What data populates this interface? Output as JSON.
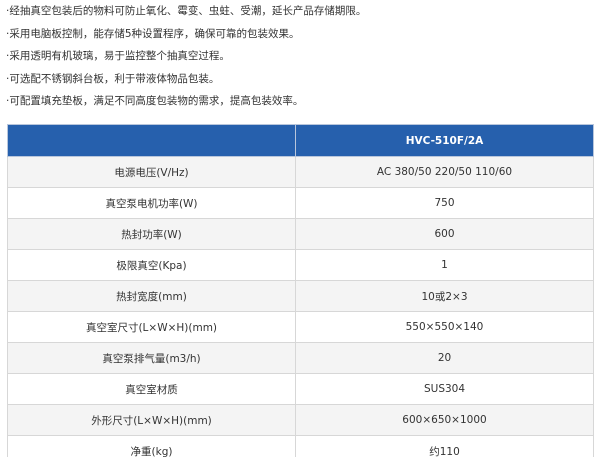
{
  "features": [
    "·经抽真空包装后的物料可防止氧化、霉变、虫蛀、受潮，延长产品存储期限。",
    "·采用电脑板控制，能存储5种设置程序，确保可靠的包装效果。",
    "·采用透明有机玻璃，易于监控整个抽真空过程。",
    "·可选配不锈钢斜台板，利于带液体物品包装。",
    "·可配置填充垫板，满足不同高度包装物的需求，提高包装效率。"
  ],
  "table": {
    "header": {
      "label": "",
      "model": "HVC-510F/2A"
    },
    "rows": [
      {
        "label": "电源电压(V/Hz)",
        "value": "AC 380/50  220/50 110/60"
      },
      {
        "label": "真空泵电机功率(W)",
        "value": "750"
      },
      {
        "label": "热封功率(W)",
        "value": "600"
      },
      {
        "label": "极限真空(Kpa)",
        "value": "1"
      },
      {
        "label": "热封宽度(mm)",
        "value": "10或2×3"
      },
      {
        "label": "真空室尺寸(L×W×H)(mm)",
        "value": "550×550×140"
      },
      {
        "label": "真空泵排气量(m3/h)",
        "value": "20"
      },
      {
        "label": "真空室材质",
        "value": "SUS304"
      },
      {
        "label": "外形尺寸(L×W×H)(mm)",
        "value": "600×650×1000"
      },
      {
        "label": "净重(kg)",
        "value": "约110"
      }
    ]
  }
}
